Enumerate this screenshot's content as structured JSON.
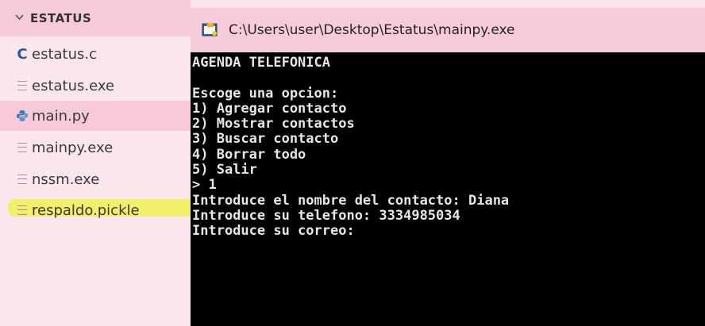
{
  "sidebar": {
    "folder_label": "ESTATUS",
    "files": [
      {
        "label": "estatus.c",
        "icon": "c-file-icon"
      },
      {
        "label": "estatus.exe",
        "icon": "file-lines-icon"
      },
      {
        "label": "main.py",
        "icon": "python-icon"
      },
      {
        "label": "mainpy.exe",
        "icon": "file-lines-icon"
      },
      {
        "label": "nssm.exe",
        "icon": "file-lines-icon"
      },
      {
        "label": "respaldo.pickle",
        "icon": "file-lines-icon"
      }
    ]
  },
  "terminal": {
    "title": "C:\\Users\\user\\Desktop\\Estatus\\mainpy.exe",
    "lines": [
      "AGENDA TELEFONICA",
      "",
      "Escoge una opcion:",
      "1) Agregar contacto",
      "2) Mostrar contactos",
      "3) Buscar contacto",
      "4) Borrar todo",
      "5) Salir",
      "> 1",
      "Introduce el nombre del contacto: Diana",
      "Introduce su telefono: 3334985034",
      "Introduce su correo:"
    ]
  },
  "colors": {
    "sidebar_bg": "#fbe6ee",
    "sidebar_header_bg": "#f6cbd9",
    "active_row_bg": "#f8c9d9",
    "highlighter": "#f3ef6b",
    "terminal_bg": "#000000",
    "terminal_text": "#e6e6e6",
    "c_icon": "#2a5aa8",
    "python_icon": "#3b7bbf"
  }
}
